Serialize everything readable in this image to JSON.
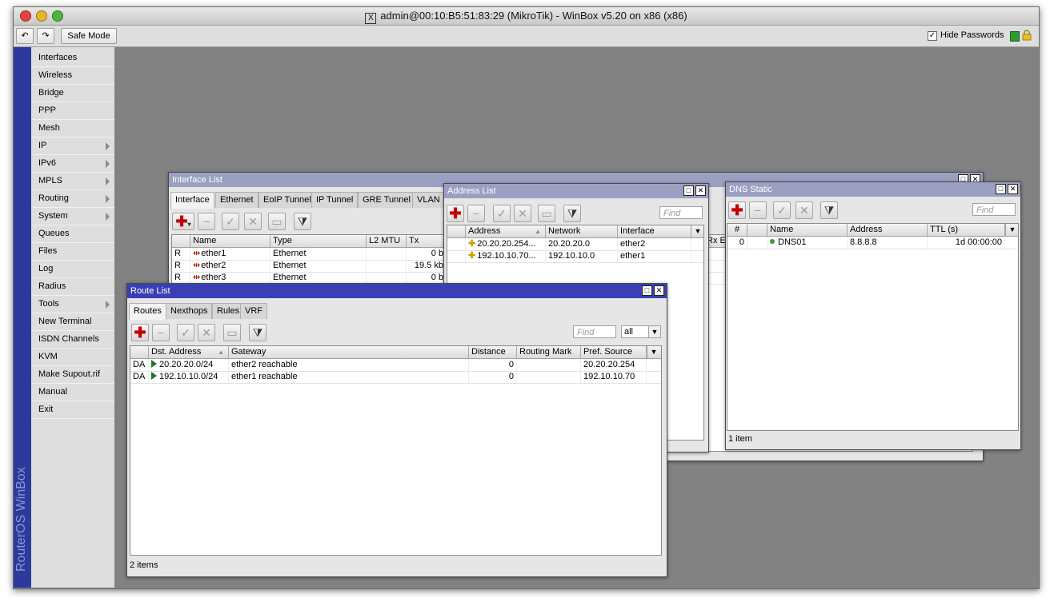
{
  "window": {
    "title": "admin@00:10:B5:51:83:29 (MikroTik) - WinBox v5.20 on x86 (x86)",
    "x_icon": "X"
  },
  "toolbar": {
    "undo_icon": "undo-icon",
    "redo_icon": "redo-icon",
    "safe_mode": "Safe Mode",
    "hide_passwords": "Hide Passwords",
    "hide_passwords_checked": true,
    "lock_icon": "lock-icon"
  },
  "sidebar": {
    "brand": "RouterOS WinBox",
    "items": [
      {
        "label": "Interfaces",
        "submenu": false
      },
      {
        "label": "Wireless",
        "submenu": false
      },
      {
        "label": "Bridge",
        "submenu": false
      },
      {
        "label": "PPP",
        "submenu": false
      },
      {
        "label": "Mesh",
        "submenu": false
      },
      {
        "label": "IP",
        "submenu": true
      },
      {
        "label": "IPv6",
        "submenu": true
      },
      {
        "label": "MPLS",
        "submenu": true
      },
      {
        "label": "Routing",
        "submenu": true
      },
      {
        "label": "System",
        "submenu": true
      },
      {
        "label": "Queues",
        "submenu": false
      },
      {
        "label": "Files",
        "submenu": false
      },
      {
        "label": "Log",
        "submenu": false
      },
      {
        "label": "Radius",
        "submenu": false
      },
      {
        "label": "Tools",
        "submenu": true
      },
      {
        "label": "New Terminal",
        "submenu": false
      },
      {
        "label": "ISDN Channels",
        "submenu": false
      },
      {
        "label": "KVM",
        "submenu": false
      },
      {
        "label": "Make Supout.rif",
        "submenu": false
      },
      {
        "label": "Manual",
        "submenu": false
      },
      {
        "label": "Exit",
        "submenu": false
      }
    ]
  },
  "interface_list": {
    "title": "Interface List",
    "tabs": [
      "Interface",
      "Ethernet",
      "EoIP Tunnel",
      "IP Tunnel",
      "GRE Tunnel",
      "VLAN"
    ],
    "columns": [
      "Name",
      "Type",
      "L2 MTU",
      "Tx"
    ],
    "hidden_col_fragment": "Rx Er",
    "rows": [
      {
        "flag": "R",
        "name": "ether1",
        "type": "Ethernet",
        "l2mtu": "",
        "tx": "0 b"
      },
      {
        "flag": "R",
        "name": "ether2",
        "type": "Ethernet",
        "l2mtu": "",
        "tx": "19.5 kb"
      },
      {
        "flag": "R",
        "name": "ether3",
        "type": "Ethernet",
        "l2mtu": "",
        "tx": "0 b"
      }
    ]
  },
  "address_list": {
    "title": "Address List",
    "find_placeholder": "Find",
    "columns": [
      "Address",
      "Network",
      "Interface"
    ],
    "rows": [
      {
        "address": "20.20.20.254...",
        "network": "20.20.20.0",
        "interface": "ether2"
      },
      {
        "address": "192.10.10.70...",
        "network": "192.10.10.0",
        "interface": "ether1"
      }
    ]
  },
  "dns_static": {
    "title": "DNS Static",
    "find_placeholder": "Find",
    "columns": [
      "#",
      "Name",
      "Address",
      "TTL (s)"
    ],
    "rows": [
      {
        "num": "0",
        "name": "DNS01",
        "address": "8.8.8.8",
        "ttl": "1d 00:00:00"
      }
    ],
    "status": "1 item"
  },
  "route_list": {
    "title": "Route List",
    "tabs": [
      "Routes",
      "Nexthops",
      "Rules",
      "VRF"
    ],
    "find_placeholder": "Find",
    "filter_value": "all",
    "columns": [
      "Dst. Address",
      "Gateway",
      "Distance",
      "Routing Mark",
      "Pref. Source"
    ],
    "rows": [
      {
        "flag": "DA",
        "dst": "20.20.20.0/24",
        "gateway": "ether2 reachable",
        "distance": "0",
        "mark": "",
        "pref": "20.20.20.254"
      },
      {
        "flag": "DA",
        "dst": "192.10.10.0/24",
        "gateway": "ether1 reachable",
        "distance": "0",
        "mark": "",
        "pref": "192.10.10.70"
      }
    ],
    "status": "2 items"
  },
  "colors": {
    "desktop": "#828282",
    "sidebar_brand_bar": "#2b3a9c",
    "active_title": "#3a3fb3",
    "inactive_title": "#9ba0c3"
  }
}
